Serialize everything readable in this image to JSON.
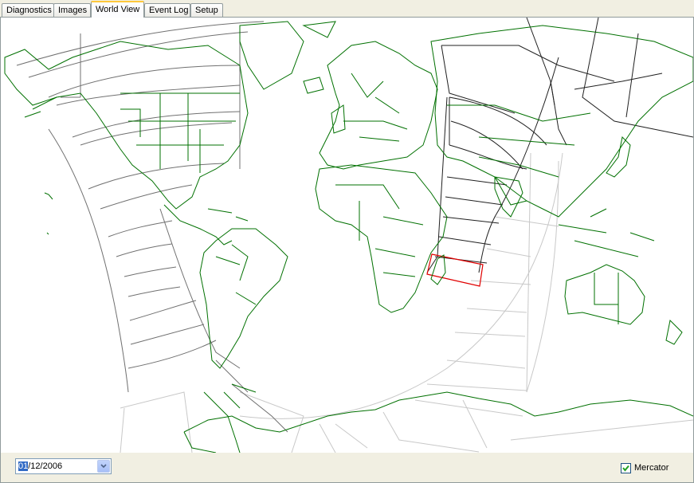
{
  "tabs": [
    {
      "label": "Diagnostics",
      "active": false
    },
    {
      "label": "Images",
      "active": false
    },
    {
      "label": "World View",
      "active": true
    },
    {
      "label": "Event Log",
      "active": false
    },
    {
      "label": "Setup",
      "active": false
    }
  ],
  "map": {
    "land_color": "#007000",
    "swath_colors": {
      "past_ascending": "#808080",
      "current_pass": "#202020",
      "descending": "#c8c8c8",
      "selected": "#e00000"
    }
  },
  "footer": {
    "date": {
      "selected_part": "01",
      "rest": "/12/2006"
    },
    "dropdown_icon": "chevron-down-icon",
    "mercator": {
      "label": "Mercator",
      "checked": true
    }
  }
}
